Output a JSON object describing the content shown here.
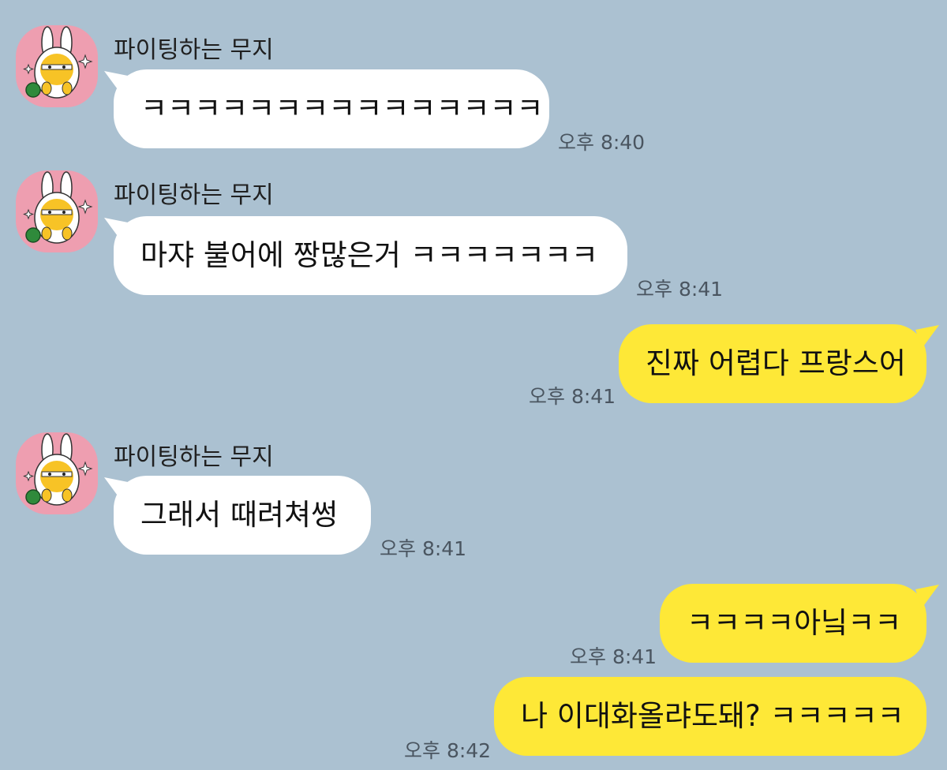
{
  "messages": [
    {
      "sender": "파이팅하는 무지",
      "text": "ㅋㅋㅋㅋㅋㅋㅋㅋㅋㅋㅋㅋㅋㅋㅋ",
      "time": "오후 8:40"
    },
    {
      "sender": "파이팅하는 무지",
      "text": "마쟈 불어에 짱많은거 ㅋㅋㅋㅋㅋㅋㅋ",
      "time": "오후 8:41"
    },
    {
      "text": "진짜 어렵다 프랑스어",
      "time": "오후 8:41"
    },
    {
      "sender": "파이팅하는 무지",
      "text": "그래서 때려쳐썽",
      "time": "오후 8:41"
    },
    {
      "text": "ㅋㅋㅋㅋ아닠ㅋㅋ",
      "time": "오후 8:41"
    },
    {
      "text": "나 이대화올랴도돼? ㅋㅋㅋㅋㅋ",
      "time": "오후 8:42"
    }
  ],
  "colors": {
    "background": "#abc1d1",
    "incoming_bubble": "#ffffff",
    "outgoing_bubble": "#fee837",
    "avatar_background": "#ee9eb0"
  }
}
